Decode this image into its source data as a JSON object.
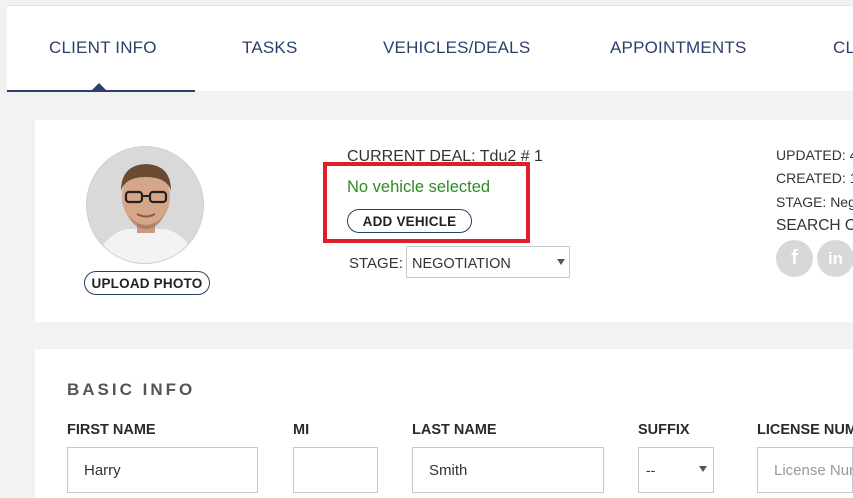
{
  "tabs": [
    {
      "label": "CLIENT INFO",
      "active": true
    },
    {
      "label": "TASKS"
    },
    {
      "label": "VEHICLES/DEALS"
    },
    {
      "label": "APPOINTMENTS"
    },
    {
      "label": "CL"
    }
  ],
  "deal": {
    "current_label": "CURRENT DEAL:",
    "current_name": "Tdu2 # 1",
    "vehicle_status": "No vehicle selected",
    "add_vehicle": "ADD VEHICLE",
    "stage_label": "STAGE:",
    "stage_value": "NEGOTIATION",
    "upload_photo": "UPLOAD PHOTO",
    "avatar_icon": "person-photo"
  },
  "meta": {
    "updated": "UPDATED: 4",
    "created": "CREATED: 1",
    "stage": "STAGE: Neg",
    "search": "SEARCH O"
  },
  "social": {
    "facebook_glyph": "f",
    "linkedin_glyph": "in"
  },
  "basic_info": {
    "title": "BASIC INFO",
    "first_name_label": "FIRST NAME",
    "first_name_value": "Harry",
    "mi_label": "MI",
    "mi_value": "",
    "last_name_label": "LAST NAME",
    "last_name_value": "Smith",
    "suffix_label": "SUFFIX",
    "suffix_value": "--",
    "license_label": "LICENSE NUM",
    "license_placeholder": "License Nur"
  },
  "colors": {
    "accent": "#2c3e6b",
    "status_green": "#2e8b24",
    "highlight_red": "#e01e2a"
  }
}
